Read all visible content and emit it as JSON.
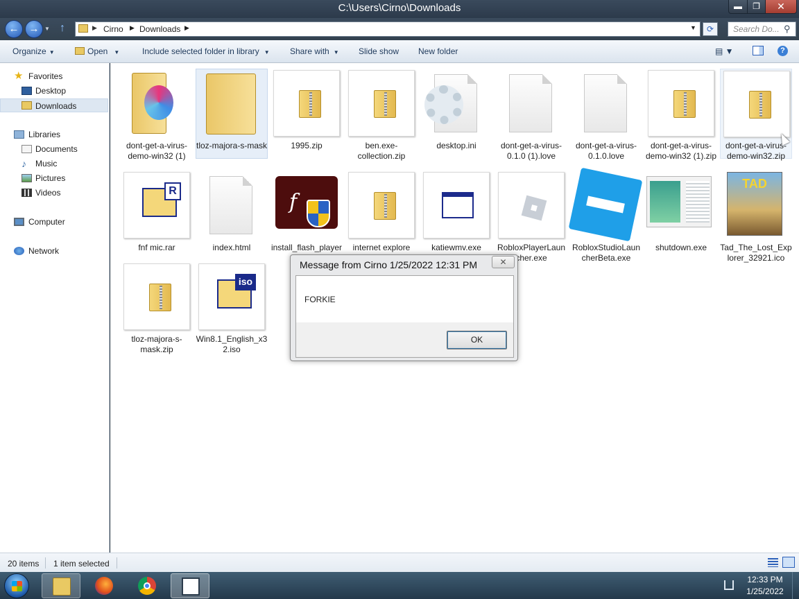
{
  "window": {
    "title": "C:\\Users\\Cirno\\Downloads",
    "minimize_glyph": "▬",
    "maximize_glyph": "❐",
    "close_glyph": "✕"
  },
  "address": {
    "back_glyph": "←",
    "forward_glyph": "→",
    "history_glyph": "▼",
    "up_glyph": "↑",
    "separator": "▶",
    "crumbs": [
      "Cirno",
      "Downloads"
    ],
    "dropdown_glyph": "▼",
    "refresh_glyph": "⟳",
    "search_placeholder": "Search Do...",
    "search_glyph": "⚲"
  },
  "toolbar": {
    "organize": "Organize",
    "open": "Open",
    "include_library": "Include selected folder in library",
    "share_with": "Share with",
    "slide_show": "Slide show",
    "new_folder": "New folder",
    "caret": "▼",
    "views_glyph": "▤ ▼",
    "help_glyph": "?"
  },
  "navpane": {
    "favorites": "Favorites",
    "desktop": "Desktop",
    "downloads": "Downloads",
    "libraries": "Libraries",
    "documents": "Documents",
    "music": "Music",
    "pictures": "Pictures",
    "videos": "Videos",
    "computer": "Computer",
    "network": "Network"
  },
  "files": [
    {
      "name": "dont-get-a-virus-demo-win32 (1)",
      "icon": "folder-disc-icon"
    },
    {
      "name": "tloz-majora-s-mask",
      "icon": "folder-icon",
      "selected": true
    },
    {
      "name": "1995.zip",
      "icon": "zip-folder-icon"
    },
    {
      "name": "ben.exe-collection.zip",
      "icon": "zip-folder-icon"
    },
    {
      "name": "desktop.ini",
      "icon": "settings-file-icon"
    },
    {
      "name": "dont-get-a-virus-0.1.0 (1).love",
      "icon": "blank-file-icon"
    },
    {
      "name": "dont-get-a-virus-0.1.0.love",
      "icon": "blank-file-icon"
    },
    {
      "name": "dont-get-a-virus-demo-win32 (1).zip",
      "icon": "zip-folder-icon"
    },
    {
      "name": "dont-get-a-virus-demo-win32.zip",
      "icon": "zip-folder-icon"
    },
    {
      "name": "fnf mic.rar",
      "icon": "rar-archive-icon"
    },
    {
      "name": "index.html",
      "icon": "blank-file-icon"
    },
    {
      "name": "install_flash_player.exe",
      "icon": "flash-installer-icon"
    },
    {
      "name": "internet explore tad.zip",
      "icon": "zip-folder-icon"
    },
    {
      "name": "katiewmv.exe",
      "icon": "exe-window-icon"
    },
    {
      "name": "RobloxPlayerLauncher.exe",
      "icon": "roblox-icon"
    },
    {
      "name": "RobloxStudioLauncherBeta.exe",
      "icon": "roblox-studio-icon"
    },
    {
      "name": "shutdown.exe",
      "icon": "screenshot-thumbnail-icon"
    },
    {
      "name": "Tad_The_Lost_Explorer_32921.ico",
      "icon": "movie-poster-thumbnail"
    },
    {
      "name": "tloz-majora-s-mask.zip",
      "icon": "zip-folder-icon"
    },
    {
      "name": "Win8.1_English_x32.iso",
      "icon": "iso-disc-image-icon"
    }
  ],
  "poster_text": "TAD",
  "rar_letter": "R",
  "iso_letters": "iso",
  "flash_letter": "f",
  "dialog": {
    "title": "Message from Cirno 1/25/2022 12:31 PM",
    "close_glyph": "✕",
    "message": "FORKIE",
    "ok": "OK"
  },
  "status": {
    "count": "20 items",
    "selected": "1 item selected"
  },
  "taskbar": {
    "time": "12:33 PM",
    "date": "1/25/2022"
  }
}
